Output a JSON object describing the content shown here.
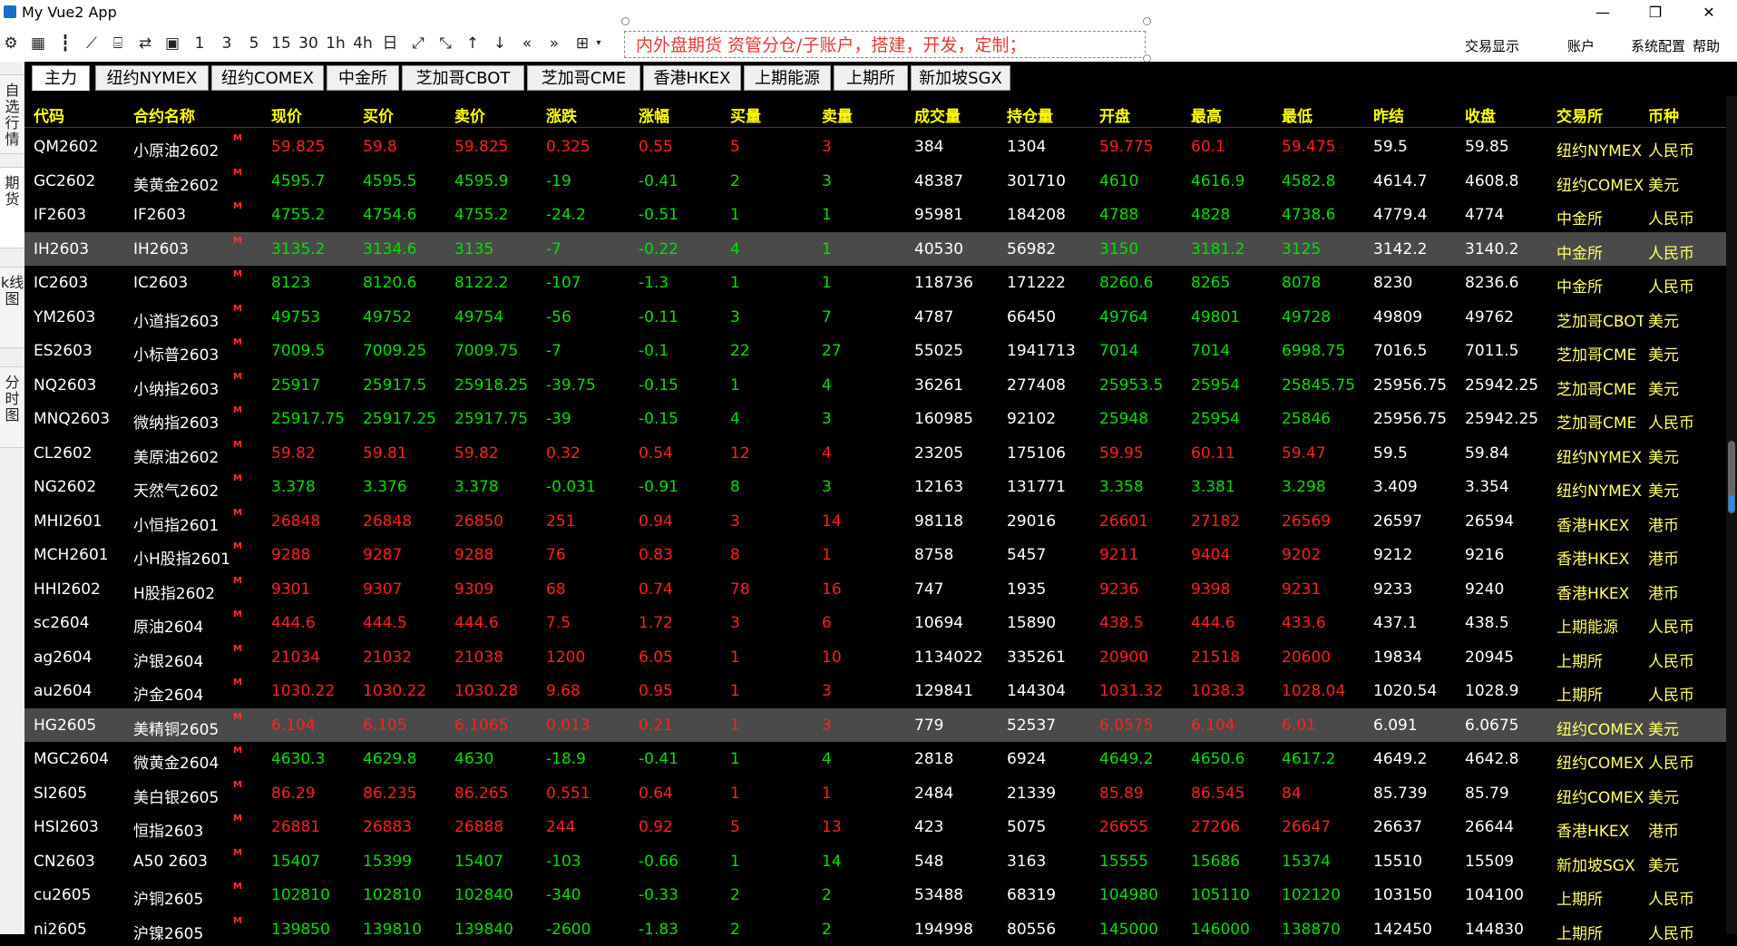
{
  "window": {
    "title": "My Vue2 App",
    "minimize": "—",
    "maximize": "❐",
    "close": "✕"
  },
  "toolbar": {
    "icons": [
      "settings-icon",
      "calculator-icon",
      "candlestick-icon",
      "line-chart-icon",
      "history-icon",
      "refresh-icon",
      "save-icon"
    ],
    "periods": [
      "1",
      "3",
      "5",
      "15",
      "30",
      "1h",
      "4h",
      "日"
    ],
    "notice": "内外盘期货 资管分仓/子账户，搭建，开发，定制；",
    "menu": [
      "交易显示",
      "账户",
      "系统配置",
      "帮助"
    ]
  },
  "sidebar": {
    "tabs": [
      "自选行情",
      "期货",
      "k线图",
      "分时图"
    ]
  },
  "market_tabs": [
    "主力",
    "纽约NYMEX",
    "纽约COMEX",
    "中金所",
    "芝加哥CBOT",
    "芝加哥CME",
    "香港HKEX",
    "上期能源",
    "上期所",
    "新加坡SGX"
  ],
  "table": {
    "headers": [
      "代码",
      "合约名称",
      "现价",
      "买价",
      "卖价",
      "涨跌",
      "涨幅",
      "买量",
      "卖量",
      "成交量",
      "持仓量",
      "开盘",
      "最高",
      "最低",
      "昨结",
      "收盘",
      "交易所",
      "币种"
    ],
    "mark": "M",
    "rows": [
      {
        "code": "QM2602",
        "name": "小原油2602",
        "last": "59.825",
        "bid": "59.8",
        "ask": "59.825",
        "chg": "0.325",
        "pct": "0.55",
        "bidv": "5",
        "askv": "3",
        "vol": "384",
        "oi": "1304",
        "open": "59.775",
        "high": "60.1",
        "low": "59.475",
        "settle": "59.5",
        "close": "59.85",
        "exch": "纽约NYMEX",
        "cur": "人民币",
        "dir": "up",
        "hl": false
      },
      {
        "code": "GC2602",
        "name": "美黄金2602",
        "last": "4595.7",
        "bid": "4595.5",
        "ask": "4595.9",
        "chg": "-19",
        "pct": "-0.41",
        "bidv": "2",
        "askv": "3",
        "vol": "48387",
        "oi": "301710",
        "open": "4610",
        "high": "4616.9",
        "low": "4582.8",
        "settle": "4614.7",
        "close": "4608.8",
        "exch": "纽约COMEX",
        "cur": "美元",
        "dir": "down",
        "hl": false
      },
      {
        "code": "IF2603",
        "name": "IF2603",
        "last": "4755.2",
        "bid": "4754.6",
        "ask": "4755.2",
        "chg": "-24.2",
        "pct": "-0.51",
        "bidv": "1",
        "askv": "1",
        "vol": "95981",
        "oi": "184208",
        "open": "4788",
        "high": "4828",
        "low": "4738.6",
        "settle": "4779.4",
        "close": "4774",
        "exch": "中金所",
        "cur": "人民币",
        "dir": "down",
        "hl": false
      },
      {
        "code": "IH2603",
        "name": "IH2603",
        "last": "3135.2",
        "bid": "3134.6",
        "ask": "3135",
        "chg": "-7",
        "pct": "-0.22",
        "bidv": "4",
        "askv": "1",
        "vol": "40530",
        "oi": "56982",
        "open": "3150",
        "high": "3181.2",
        "low": "3125",
        "settle": "3142.2",
        "close": "3140.2",
        "exch": "中金所",
        "cur": "人民币",
        "dir": "down",
        "hl": true
      },
      {
        "code": "IC2603",
        "name": "IC2603",
        "last": "8123",
        "bid": "8120.6",
        "ask": "8122.2",
        "chg": "-107",
        "pct": "-1.3",
        "bidv": "1",
        "askv": "1",
        "vol": "118736",
        "oi": "171222",
        "open": "8260.6",
        "high": "8265",
        "low": "8078",
        "settle": "8230",
        "close": "8236.6",
        "exch": "中金所",
        "cur": "人民币",
        "dir": "down",
        "hl": false
      },
      {
        "code": "YM2603",
        "name": "小道指2603",
        "last": "49753",
        "bid": "49752",
        "ask": "49754",
        "chg": "-56",
        "pct": "-0.11",
        "bidv": "3",
        "askv": "7",
        "vol": "4787",
        "oi": "66450",
        "open": "49764",
        "high": "49801",
        "low": "49728",
        "settle": "49809",
        "close": "49762",
        "exch": "芝加哥CBOT",
        "cur": "美元",
        "dir": "down",
        "hl": false
      },
      {
        "code": "ES2603",
        "name": "小标普2603",
        "last": "7009.5",
        "bid": "7009.25",
        "ask": "7009.75",
        "chg": "-7",
        "pct": "-0.1",
        "bidv": "22",
        "askv": "27",
        "vol": "55025",
        "oi": "1941713",
        "open": "7014",
        "high": "7014",
        "low": "6998.75",
        "settle": "7016.5",
        "close": "7011.5",
        "exch": "芝加哥CME",
        "cur": "美元",
        "dir": "down",
        "hl": false
      },
      {
        "code": "NQ2603",
        "name": "小纳指2603",
        "last": "25917",
        "bid": "25917.5",
        "ask": "25918.25",
        "chg": "-39.75",
        "pct": "-0.15",
        "bidv": "1",
        "askv": "4",
        "vol": "36261",
        "oi": "277408",
        "open": "25953.5",
        "high": "25954",
        "low": "25845.75",
        "settle": "25956.75",
        "close": "25942.25",
        "exch": "芝加哥CME",
        "cur": "美元",
        "dir": "down",
        "hl": false
      },
      {
        "code": "MNQ2603",
        "name": "微纳指2603",
        "last": "25917.75",
        "bid": "25917.25",
        "ask": "25917.75",
        "chg": "-39",
        "pct": "-0.15",
        "bidv": "4",
        "askv": "3",
        "vol": "160985",
        "oi": "92102",
        "open": "25948",
        "high": "25954",
        "low": "25846",
        "settle": "25956.75",
        "close": "25942.25",
        "exch": "芝加哥CME",
        "cur": "人民币",
        "dir": "down",
        "hl": false
      },
      {
        "code": "CL2602",
        "name": "美原油2602",
        "last": "59.82",
        "bid": "59.81",
        "ask": "59.82",
        "chg": "0.32",
        "pct": "0.54",
        "bidv": "12",
        "askv": "4",
        "vol": "23205",
        "oi": "175106",
        "open": "59.95",
        "high": "60.11",
        "low": "59.47",
        "settle": "59.5",
        "close": "59.84",
        "exch": "纽约NYMEX",
        "cur": "美元",
        "dir": "up",
        "hl": false
      },
      {
        "code": "NG2602",
        "name": "天然气2602",
        "last": "3.378",
        "bid": "3.376",
        "ask": "3.378",
        "chg": "-0.031",
        "pct": "-0.91",
        "bidv": "8",
        "askv": "3",
        "vol": "12163",
        "oi": "131771",
        "open": "3.358",
        "high": "3.381",
        "low": "3.298",
        "settle": "3.409",
        "close": "3.354",
        "exch": "纽约NYMEX",
        "cur": "美元",
        "dir": "down",
        "hl": false
      },
      {
        "code": "MHI2601",
        "name": "小恒指2601",
        "last": "26848",
        "bid": "26848",
        "ask": "26850",
        "chg": "251",
        "pct": "0.94",
        "bidv": "3",
        "askv": "14",
        "vol": "98118",
        "oi": "29016",
        "open": "26601",
        "high": "27182",
        "low": "26569",
        "settle": "26597",
        "close": "26594",
        "exch": "香港HKEX",
        "cur": "港币",
        "dir": "up",
        "hl": false
      },
      {
        "code": "MCH2601",
        "name": "小H股指2601",
        "last": "9288",
        "bid": "9287",
        "ask": "9288",
        "chg": "76",
        "pct": "0.83",
        "bidv": "8",
        "askv": "1",
        "vol": "8758",
        "oi": "5457",
        "open": "9211",
        "high": "9404",
        "low": "9202",
        "settle": "9212",
        "close": "9216",
        "exch": "香港HKEX",
        "cur": "港币",
        "dir": "up",
        "hl": false
      },
      {
        "code": "HHI2602",
        "name": "H股指2602",
        "last": "9301",
        "bid": "9307",
        "ask": "9309",
        "chg": "68",
        "pct": "0.74",
        "bidv": "78",
        "askv": "16",
        "vol": "747",
        "oi": "1935",
        "open": "9236",
        "high": "9398",
        "low": "9231",
        "settle": "9233",
        "close": "9240",
        "exch": "香港HKEX",
        "cur": "港币",
        "dir": "up",
        "hl": false
      },
      {
        "code": "sc2604",
        "name": "原油2604",
        "last": "444.6",
        "bid": "444.5",
        "ask": "444.6",
        "chg": "7.5",
        "pct": "1.72",
        "bidv": "3",
        "askv": "6",
        "vol": "10694",
        "oi": "15890",
        "open": "438.5",
        "high": "444.6",
        "low": "433.6",
        "settle": "437.1",
        "close": "438.5",
        "exch": "上期能源",
        "cur": "人民币",
        "dir": "up",
        "hl": false
      },
      {
        "code": "ag2604",
        "name": "沪银2604",
        "last": "21034",
        "bid": "21032",
        "ask": "21038",
        "chg": "1200",
        "pct": "6.05",
        "bidv": "1",
        "askv": "10",
        "vol": "1134022",
        "oi": "335261",
        "open": "20900",
        "high": "21518",
        "low": "20600",
        "settle": "19834",
        "close": "20945",
        "exch": "上期所",
        "cur": "人民币",
        "dir": "up",
        "hl": false
      },
      {
        "code": "au2604",
        "name": "沪金2604",
        "last": "1030.22",
        "bid": "1030.22",
        "ask": "1030.28",
        "chg": "9.68",
        "pct": "0.95",
        "bidv": "1",
        "askv": "3",
        "vol": "129841",
        "oi": "144304",
        "open": "1031.32",
        "high": "1038.3",
        "low": "1028.04",
        "settle": "1020.54",
        "close": "1028.9",
        "exch": "上期所",
        "cur": "人民币",
        "dir": "up",
        "hl": false
      },
      {
        "code": "HG2605",
        "name": "美精铜2605",
        "last": "6.104",
        "bid": "6.105",
        "ask": "6.1065",
        "chg": "0.013",
        "pct": "0.21",
        "bidv": "1",
        "askv": "3",
        "vol": "779",
        "oi": "52537",
        "open": "6.0575",
        "high": "6.104",
        "low": "6.01",
        "settle": "6.091",
        "close": "6.0675",
        "exch": "纽约COMEX",
        "cur": "美元",
        "dir": "up",
        "hl": true
      },
      {
        "code": "MGC2604",
        "name": "微黄金2604",
        "last": "4630.3",
        "bid": "4629.8",
        "ask": "4630",
        "chg": "-18.9",
        "pct": "-0.41",
        "bidv": "1",
        "askv": "4",
        "vol": "2818",
        "oi": "6924",
        "open": "4649.2",
        "high": "4650.6",
        "low": "4617.2",
        "settle": "4649.2",
        "close": "4642.8",
        "exch": "纽约COMEX",
        "cur": "人民币",
        "dir": "down",
        "hl": false
      },
      {
        "code": "SI2605",
        "name": "美白银2605",
        "last": "86.29",
        "bid": "86.235",
        "ask": "86.265",
        "chg": "0.551",
        "pct": "0.64",
        "bidv": "1",
        "askv": "1",
        "vol": "2484",
        "oi": "21339",
        "open": "85.89",
        "high": "86.545",
        "low": "84",
        "settle": "85.739",
        "close": "85.79",
        "exch": "纽约COMEX",
        "cur": "美元",
        "dir": "up",
        "hl": false
      },
      {
        "code": "HSI2603",
        "name": "恒指2603",
        "last": "26881",
        "bid": "26883",
        "ask": "26888",
        "chg": "244",
        "pct": "0.92",
        "bidv": "5",
        "askv": "13",
        "vol": "423",
        "oi": "5075",
        "open": "26655",
        "high": "27206",
        "low": "26647",
        "settle": "26637",
        "close": "26644",
        "exch": "香港HKEX",
        "cur": "港币",
        "dir": "up",
        "hl": false
      },
      {
        "code": "CN2603",
        "name": "A50 2603",
        "last": "15407",
        "bid": "15399",
        "ask": "15407",
        "chg": "-103",
        "pct": "-0.66",
        "bidv": "1",
        "askv": "14",
        "vol": "548",
        "oi": "3163",
        "open": "15555",
        "high": "15686",
        "low": "15374",
        "settle": "15510",
        "close": "15509",
        "exch": "新加坡SGX",
        "cur": "美元",
        "dir": "down",
        "hl": false
      },
      {
        "code": "cu2605",
        "name": "沪铜2605",
        "last": "102810",
        "bid": "102810",
        "ask": "102840",
        "chg": "-340",
        "pct": "-0.33",
        "bidv": "2",
        "askv": "2",
        "vol": "53488",
        "oi": "68319",
        "open": "104980",
        "high": "105110",
        "low": "102120",
        "settle": "103150",
        "close": "104100",
        "exch": "上期所",
        "cur": "人民币",
        "dir": "down",
        "hl": false
      },
      {
        "code": "ni2605",
        "name": "沪镍2605",
        "last": "139850",
        "bid": "139810",
        "ask": "139840",
        "chg": "-2600",
        "pct": "-1.83",
        "bidv": "2",
        "askv": "2",
        "vol": "194998",
        "oi": "80556",
        "open": "145000",
        "high": "146000",
        "low": "138870",
        "settle": "142450",
        "close": "144830",
        "exch": "上期所",
        "cur": "人民币",
        "dir": "down",
        "hl": false
      }
    ]
  }
}
